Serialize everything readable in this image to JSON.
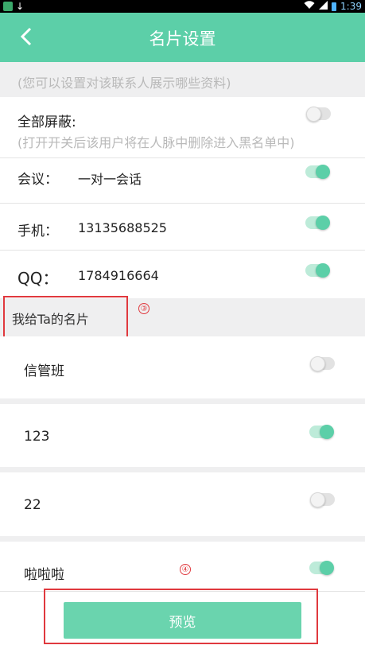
{
  "status_bar": {
    "time": "1:39",
    "battery_label": "▯"
  },
  "header": {
    "title": "名片设置",
    "back_icon": "chevron-left-icon"
  },
  "hint": "(您可以设置对该联系人展示哪些资料)",
  "block_all": {
    "label": "全部屏蔽:",
    "hint": "(打开开关后该用户将在人脉中删除进入黑名单中)",
    "enabled": false
  },
  "fields": [
    {
      "label": "会议：",
      "value": "一对一会话",
      "enabled": true
    },
    {
      "label": "手机：",
      "value": "13135688525",
      "enabled": true
    },
    {
      "label": "QQ：",
      "value": "1784916664",
      "enabled": true
    }
  ],
  "section_title": "我给Ta的名片",
  "annotations": {
    "marker_3": "③",
    "marker_4": "④"
  },
  "cards": [
    {
      "name": "信管班",
      "enabled": false
    },
    {
      "name": "123",
      "enabled": true
    },
    {
      "name": "22",
      "enabled": false
    },
    {
      "name": "啦啦啦",
      "enabled": true
    }
  ],
  "preview_button": "预览",
  "colors": {
    "accent": "#5ccfa8",
    "annotation_red": "#e0393e"
  }
}
